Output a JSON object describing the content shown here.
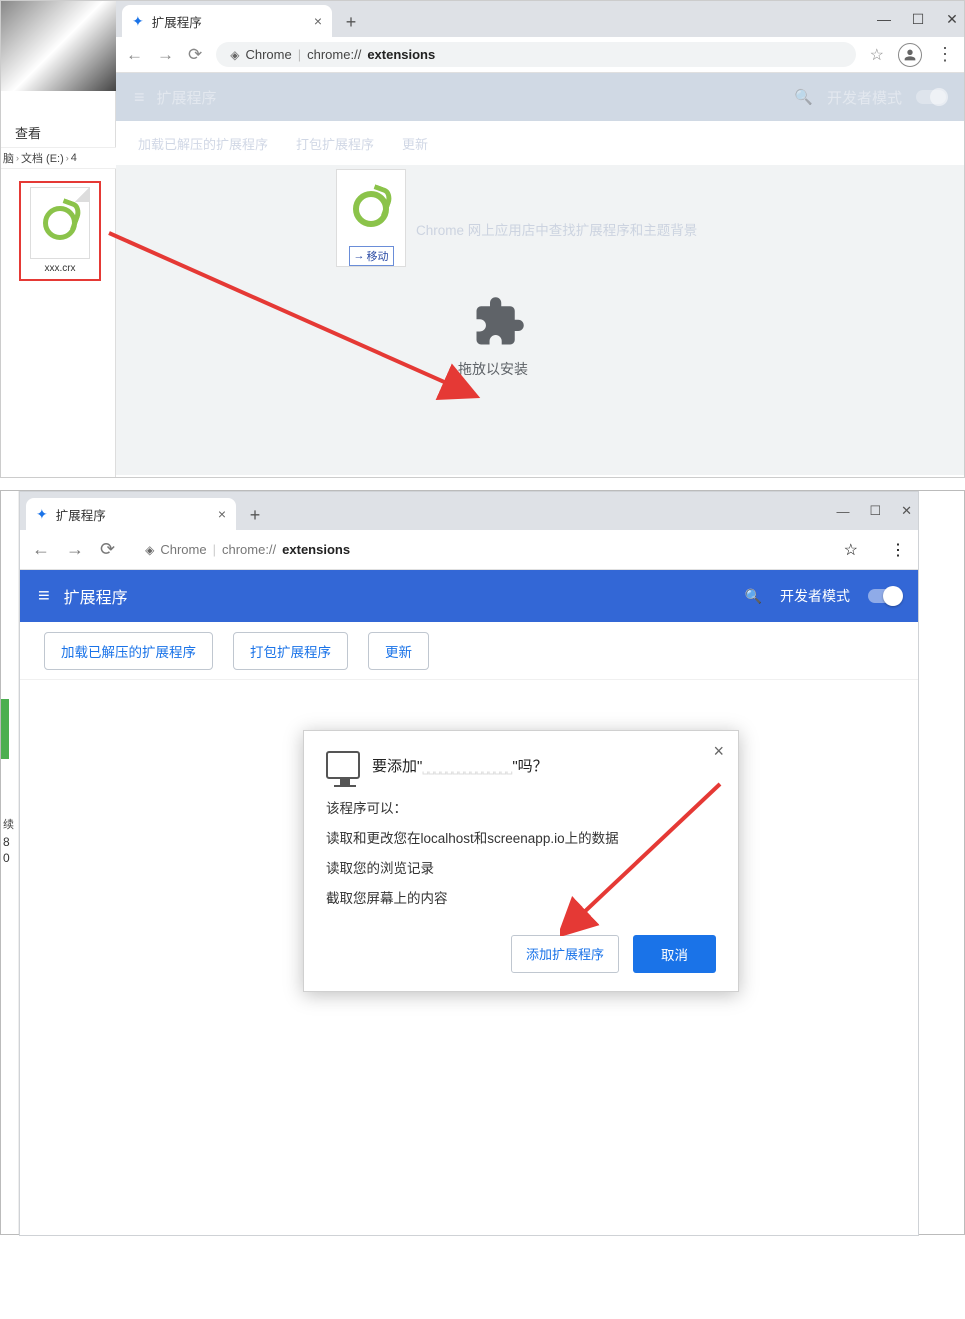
{
  "panel1": {
    "explorer": {
      "menu": "查看",
      "bread1": "脑",
      "bread2": "文档 (E:)",
      "bread3": "4",
      "file_name": "xxx.crx"
    },
    "tab_title": "扩展程序",
    "omnibox_prefix": "Chrome",
    "omnibox_path_a": "chrome://",
    "omnibox_path_b": "extensions",
    "header": "扩展程序",
    "dev_mode": "开发者模式",
    "dim_btn1": "加载已解压的扩展程序",
    "dim_btn2": "打包扩展程序",
    "dim_btn3": "更新",
    "move_hint": "移动",
    "faint_text": "Chrome 网上应用店中查找扩展程序和主题背景",
    "drop_label": "拖放以安装"
  },
  "panel2": {
    "tab_title": "扩展程序",
    "omnibox_prefix": "Chrome",
    "omnibox_path_a": "chrome://",
    "omnibox_path_b": "extensions",
    "header": "扩展程序",
    "dev_mode": "开发者模式",
    "btn_load": "加载已解压的扩展程序",
    "btn_pack": "打包扩展程序",
    "btn_update": "更新",
    "sidebar_t1": "续",
    "sidebar_t2": "8",
    "sidebar_t3": "0",
    "dialog": {
      "title_a": "要添加\"",
      "title_b": "\"吗？",
      "line1": "该程序可以：",
      "line2": "读取和更改您在localhost和screenapp.io上的数据",
      "line3": "读取您的浏览记录",
      "line4": "截取您屏幕上的内容",
      "add": "添加扩展程序",
      "cancel": "取消"
    }
  }
}
